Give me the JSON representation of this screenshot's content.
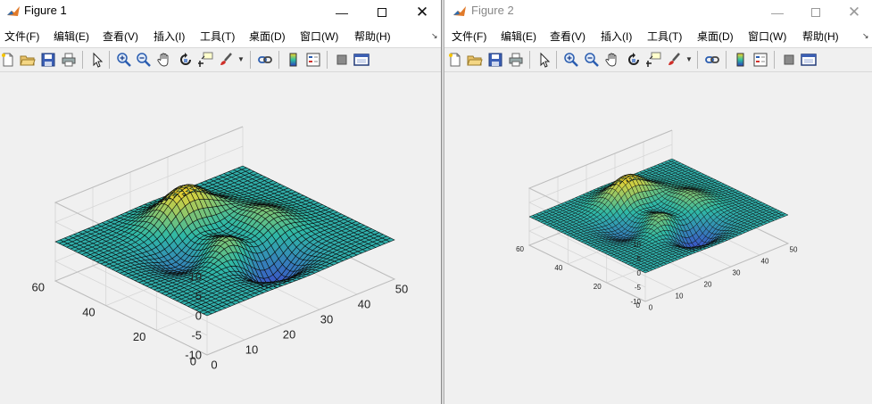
{
  "windows": [
    {
      "title": "Figure 1",
      "menus": [
        "文件(F)",
        "编辑(E)",
        "查看(V)",
        "插入(I)",
        "工具(T)",
        "桌面(D)",
        "窗口(W)",
        "帮助(H)"
      ],
      "axes": {
        "z_ticks": [
          "10",
          "5",
          "0",
          "-5",
          "-10"
        ],
        "y_ticks": [
          "60",
          "40",
          "20",
          "0"
        ],
        "x_ticks": [
          "0",
          "10",
          "20",
          "30",
          "40",
          "50"
        ]
      }
    },
    {
      "title": "Figure 2",
      "menus": [
        "文件(F)",
        "编辑(E)",
        "查看(V)",
        "插入(I)",
        "工具(T)",
        "桌面(D)",
        "窗口(W)",
        "帮助(H)"
      ],
      "axes": {
        "z_ticks": [
          "10",
          "5",
          "0",
          "-5",
          "-10"
        ],
        "y_ticks": [
          "60",
          "40",
          "20",
          "0"
        ],
        "x_ticks": [
          "0",
          "10",
          "20",
          "30",
          "40",
          "50"
        ]
      }
    }
  ],
  "icons": [
    "new-file-icon",
    "open-folder-icon",
    "save-icon",
    "print-icon",
    "pointer-icon",
    "zoom-in-icon",
    "zoom-out-icon",
    "pan-hand-icon",
    "rotate-3d-icon",
    "data-cursor-icon",
    "brush-icon",
    "link-plot-icon",
    "colorbar-icon",
    "legend-icon",
    "hide-plot-tools-icon",
    "show-plot-tools-icon"
  ],
  "colors": {
    "surface_low": "#3a53c8",
    "surface_mid": "#2fb8a6",
    "surface_high": "#f6d52a",
    "mesh": "#0a0a0a",
    "axes_bg": "#f0f0f0"
  }
}
